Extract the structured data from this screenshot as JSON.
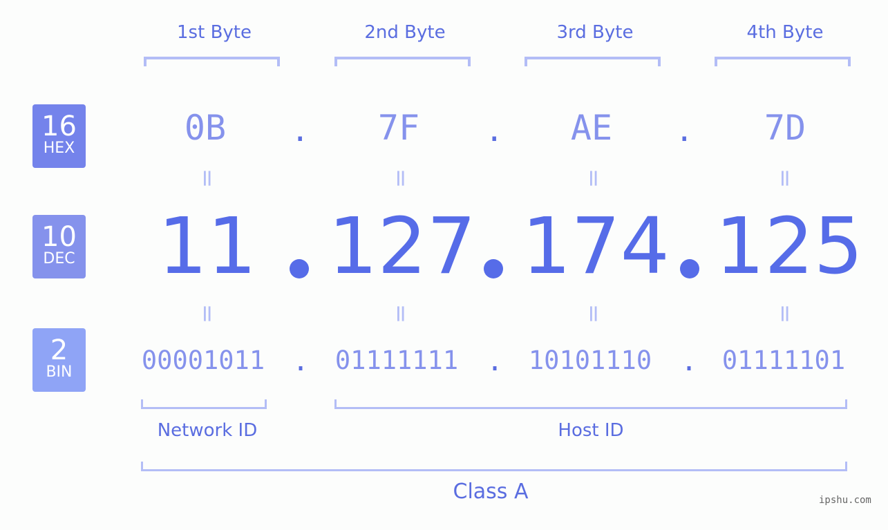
{
  "bases": [
    {
      "number": "16",
      "label": "HEX",
      "color": "#7483eb"
    },
    {
      "number": "10",
      "label": "DEC",
      "color": "#8592ec"
    },
    {
      "number": "2",
      "label": "BIN",
      "color": "#8fa4f6"
    }
  ],
  "byte_headers": [
    "1st Byte",
    "2nd Byte",
    "3rd Byte",
    "4th Byte"
  ],
  "hex": [
    "0B",
    "7F",
    "AE",
    "7D"
  ],
  "dec": [
    "11",
    "127",
    "174",
    "125"
  ],
  "bin": [
    "00001011",
    "01111111",
    "10101110",
    "01111101"
  ],
  "separator": ".",
  "equals": "=",
  "segments": {
    "network_id": "Network ID",
    "host_id": "Host ID",
    "class": "Class A"
  },
  "watermark": "ipshu.com",
  "colors": {
    "accent": "#566ce8",
    "light": "#8592ec",
    "bracket": "#b3bdf6"
  }
}
